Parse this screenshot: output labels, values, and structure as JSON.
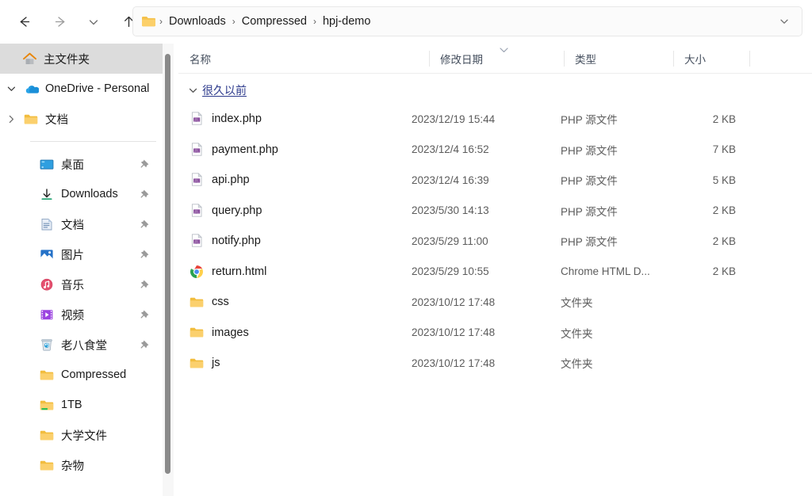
{
  "window": {
    "title": "hpj-demo"
  },
  "toolbar": {
    "back_label": "Back",
    "forward_label": "Forward",
    "recent_label": "Recent locations",
    "up_label": "Up to Compressed"
  },
  "address": {
    "folder_icon": "folder-icon",
    "separator": "›",
    "dropdown_icon": "chevron-down-icon",
    "crumbs": [
      {
        "label": "Downloads"
      },
      {
        "label": "Compressed"
      },
      {
        "label": "hpj-demo"
      }
    ]
  },
  "sidebar": {
    "items": [
      {
        "label": "主文件夹",
        "icon": "home-icon",
        "selected": true,
        "chevron": "",
        "indent": 0,
        "pinned": false
      },
      {
        "label": "OneDrive - Personal",
        "icon": "onedrive-cloud-icon",
        "selected": false,
        "chevron": "expanded",
        "indent": 0,
        "pinned": false
      },
      {
        "label": "文档",
        "icon": "folder-icon",
        "selected": false,
        "chevron": "collapsed",
        "indent": 1,
        "pinned": false
      },
      {
        "divider": true
      },
      {
        "label": "桌面",
        "icon": "desktop-icon",
        "selected": false,
        "chevron": "",
        "indent": 1,
        "pinned": true
      },
      {
        "label": "Downloads",
        "icon": "downloads-icon",
        "selected": false,
        "chevron": "",
        "indent": 1,
        "pinned": true
      },
      {
        "label": "文档",
        "icon": "documents-icon",
        "selected": false,
        "chevron": "",
        "indent": 1,
        "pinned": true
      },
      {
        "label": "图片",
        "icon": "pictures-icon",
        "selected": false,
        "chevron": "",
        "indent": 1,
        "pinned": true
      },
      {
        "label": "音乐",
        "icon": "music-icon",
        "selected": false,
        "chevron": "",
        "indent": 1,
        "pinned": true
      },
      {
        "label": "视频",
        "icon": "videos-icon",
        "selected": false,
        "chevron": "",
        "indent": 1,
        "pinned": true
      },
      {
        "label": "老八食堂",
        "icon": "recycle-bin-icon",
        "selected": false,
        "chevron": "",
        "indent": 1,
        "pinned": true
      },
      {
        "label": "Compressed",
        "icon": "folder-icon",
        "selected": false,
        "chevron": "",
        "indent": 1,
        "pinned": false
      },
      {
        "label": "1TB",
        "icon": "folder-drive-icon",
        "selected": false,
        "chevron": "",
        "indent": 1,
        "pinned": false
      },
      {
        "label": "大学文件",
        "icon": "folder-icon",
        "selected": false,
        "chevron": "",
        "indent": 1,
        "pinned": false
      },
      {
        "label": "杂物",
        "icon": "folder-icon",
        "selected": false,
        "chevron": "",
        "indent": 1,
        "pinned": false
      }
    ]
  },
  "filelist": {
    "columns": [
      {
        "label": "名称",
        "sorted": false
      },
      {
        "label": "修改日期",
        "sorted": true,
        "sort_icon": "chevron-down-icon"
      },
      {
        "label": "类型",
        "sorted": false
      },
      {
        "label": "大小",
        "sorted": false
      }
    ],
    "group": {
      "label": "很久以前",
      "chevron": "chevron-down-icon",
      "expanded": true
    },
    "rows": [
      {
        "name": "index.php",
        "date": "2023/12/19 15:44",
        "type": "PHP 源文件",
        "size": "2 KB",
        "icon": "php-file-icon"
      },
      {
        "name": "payment.php",
        "date": "2023/12/4 16:52",
        "type": "PHP 源文件",
        "size": "7 KB",
        "icon": "php-file-icon"
      },
      {
        "name": "api.php",
        "date": "2023/12/4 16:39",
        "type": "PHP 源文件",
        "size": "5 KB",
        "icon": "php-file-icon"
      },
      {
        "name": "query.php",
        "date": "2023/5/30 14:13",
        "type": "PHP 源文件",
        "size": "2 KB",
        "icon": "php-file-icon"
      },
      {
        "name": "notify.php",
        "date": "2023/5/29 11:00",
        "type": "PHP 源文件",
        "size": "2 KB",
        "icon": "php-file-icon"
      },
      {
        "name": "return.html",
        "date": "2023/5/29 10:55",
        "type": "Chrome HTML D...",
        "size": "2 KB",
        "icon": "chrome-icon"
      },
      {
        "name": "css",
        "date": "2023/10/12 17:48",
        "type": "文件夹",
        "size": "",
        "icon": "folder-icon"
      },
      {
        "name": "images",
        "date": "2023/10/12 17:48",
        "type": "文件夹",
        "size": "",
        "icon": "folder-icon"
      },
      {
        "name": "js",
        "date": "2023/10/12 17:48",
        "type": "文件夹",
        "size": "",
        "icon": "folder-icon"
      }
    ]
  },
  "colors": {
    "folder_yellow": "#fbc13a",
    "accent_blue": "#2d3a8c",
    "selection_gray": "#dcdcdc",
    "php_purple": "#8a4f9e",
    "text_primary": "#1a1a1a",
    "text_secondary": "#5c5c5c"
  }
}
